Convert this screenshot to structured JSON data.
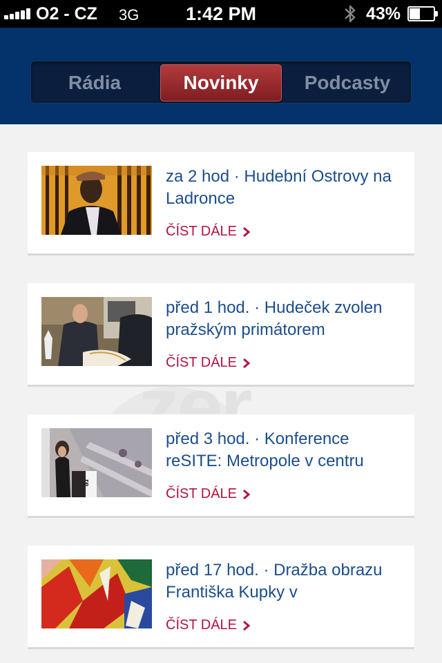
{
  "status_bar": {
    "carrier": "O2 - CZ",
    "network": "3G",
    "time": "1:42 PM",
    "battery_percent": "43%",
    "battery_level": 0.43,
    "signal_bars": 5,
    "icons": [
      "signal-icon",
      "bluetooth-icon",
      "battery-icon"
    ]
  },
  "tabs": [
    {
      "label": "Rádia",
      "selected": false
    },
    {
      "label": "Novinky",
      "selected": true
    },
    {
      "label": "Podcasty",
      "selected": false
    }
  ],
  "colors": {
    "header": "#04326b",
    "active_tab": "#9a2a2e",
    "title_text": "#1c4d8c",
    "read_more": "#b0143f"
  },
  "news": [
    {
      "title": "za 2 hod · Hudební Ostrovy na Ladronce",
      "read_more": "ČÍST DÁLE",
      "image": "man-in-cap-photo"
    },
    {
      "title": "před 1 hod. · Hudeček zvolen pražským primátorem",
      "read_more": "ČÍST DÁLE",
      "image": "city-council-photo"
    },
    {
      "title": "před 3 hod. · Konference reSITE: Metropole v centru",
      "read_more": "ČÍST DÁLE",
      "image": "conference-speaker-photo"
    },
    {
      "title": "před 17 hod. · Dražba obrazu Františka Kupky v",
      "read_more": "ČÍST DÁLE",
      "image": "abstract-painting-photo"
    }
  ]
}
